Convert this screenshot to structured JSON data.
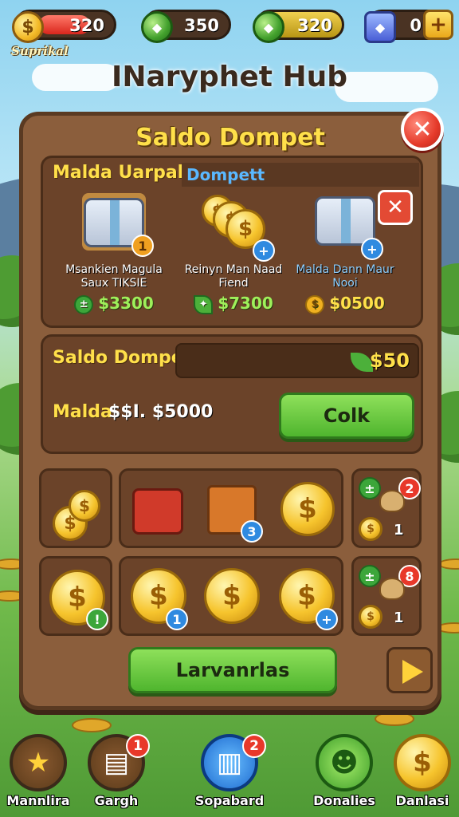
{
  "topbar": {
    "resources": [
      {
        "name": "gold",
        "value": "320",
        "icon": "gold-coin-icon",
        "fill_percent": 65,
        "color": "#e53a3a"
      },
      {
        "name": "gem",
        "value": "350",
        "icon": "green-gem-icon",
        "color": "#4a3323"
      },
      {
        "name": "energy",
        "value": "320",
        "icon": "green-gem-coin-icon",
        "color": "#c9a820"
      },
      {
        "name": "shield",
        "value": "0",
        "icon": "blue-shield-icon",
        "color": "#4a3323"
      }
    ],
    "gold_label": "Suprikal",
    "add_label": "+"
  },
  "hub_title": "INaryphet Hub",
  "panel": {
    "title": "Saldo Dompet",
    "close_label": "✕",
    "offers_section": {
      "title": "Malda Uarpah",
      "subtitle": "Dompett",
      "close_label": "✕",
      "offers": [
        {
          "name": "Msankien Magula Saux TIKSIE",
          "price": "$3300",
          "badge": "1",
          "icon": "chest-icon",
          "price_icon": "green-coin-icon"
        },
        {
          "name": "Reinyn Man Naad Fiend",
          "price": "$7300",
          "badge": "+",
          "icon": "coin-stack-icon",
          "price_icon": "leaf-icon"
        },
        {
          "name": "Malda Dann Maur Nooi",
          "price": "$0500",
          "badge": "+",
          "icon": "chest-icon",
          "price_icon": "gold-coin-icon"
        }
      ]
    },
    "balance_section": {
      "label": "Saldo Dompett",
      "value": "$50",
      "malda_label": "Malda",
      "malda_value": "$$I. $5000",
      "button_label": "Colk"
    },
    "grid": {
      "row1": {
        "chest_badge": "3",
        "side_counts": [
          "2",
          "1"
        ]
      },
      "row2": {
        "coin_badges": [
          "!",
          "1",
          "+"
        ],
        "side_counts": [
          "8",
          "1"
        ]
      }
    },
    "bottom_button": "Larvanrlas"
  },
  "nav": [
    {
      "label": "Mannlira",
      "icon": "star-icon",
      "badge": ""
    },
    {
      "label": "Gargh",
      "icon": "book-icon",
      "badge": "1"
    },
    {
      "label": "Sopabard",
      "icon": "stacked-books-icon",
      "badge": "2"
    },
    {
      "label": "Donalies",
      "icon": "green-creature-icon",
      "badge": ""
    },
    {
      "label": "Danlasi",
      "icon": "dollar-coin-icon",
      "badge": ""
    }
  ]
}
